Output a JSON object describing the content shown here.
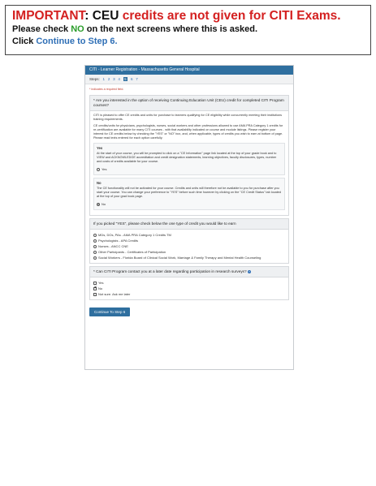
{
  "banner": {
    "important": "IMPORTANT",
    "ceu": "CEU",
    "rest": "credits are not given for CITI Exams.",
    "line2_pre": "Please check",
    "line2_no": "NO",
    "line2_post": "on the next screens where this is asked.",
    "line3_pre": "Click",
    "line3_link": "Continue to Step 6."
  },
  "screen": {
    "header": "CITI - Learner Registration - Massachusetts General Hospital",
    "steps_label": "Steps:",
    "steps": [
      "1",
      "2",
      "3",
      "4",
      "5",
      "6",
      "7"
    ],
    "active_step": "5",
    "required_note": "* indicates a required field.",
    "q1": {
      "title": "* Are you interested in the option of receiving Continuing Education Unit (CEU) credit for completed CITI Program courses?",
      "para1": "CITI is pleased to offer CE credits and units for purchase to learners qualifying for CE eligibility while concurrently meeting their institutions training requirements.",
      "para2": "CE credits/units for physicians, psychologists, nurses, social workers and other professions allowed to use AMA PRA Category 1 credits for re-certification are available for many CITI courses - with that availability indicated on course and module listings. Please register your interest for CE credits below by checking the \"YES\" or \"NO\" box, and, when applicable, types of credits you wish to earn at bottom of page. Please read texts entered for each option carefully.",
      "yes_title": "Yes",
      "yes_text": "At the start of your course, you will be prompted to click on a \"CE Information\" page link located at the top of your grade book and to VIEW and ACKNOWLEDGE accreditation and credit designation statements, learning objectives, faculty disclosures, types, number and costs of credits available for your course.",
      "yes_option": "Yes",
      "no_title": "No",
      "no_text": "The CE functionality will not be activated for your course. Credits and units will therefore not be available to you for purchase after you start your course. You can change your preference to \"YES\" before such time however by clicking on the \"CE Credit Status\" tab located at the top of your grad book page.",
      "no_option": "No"
    },
    "q2": {
      "title": "If you picked \"YES\", please check below the one type of credit you would like to earn",
      "options": [
        "MDs, DOs, PAs - AMA PRA Category 1 Credits TM",
        "Psychologists - APA Credits",
        "Nurses - ANCC CNE",
        "Other Participants - Certificates of Participation",
        "Social Workers - Florida Board of Clinical Social Work, Marriage & Family Therapy and Mental Health Counseling"
      ]
    },
    "q3": {
      "title": "* Can CITI Program contact you at a later date regarding participation in research surveys?",
      "options": [
        "Yes",
        "No",
        "Not sure. Ask me later"
      ],
      "checked_index": 1
    },
    "continue_button": "Continue To Step 6"
  }
}
